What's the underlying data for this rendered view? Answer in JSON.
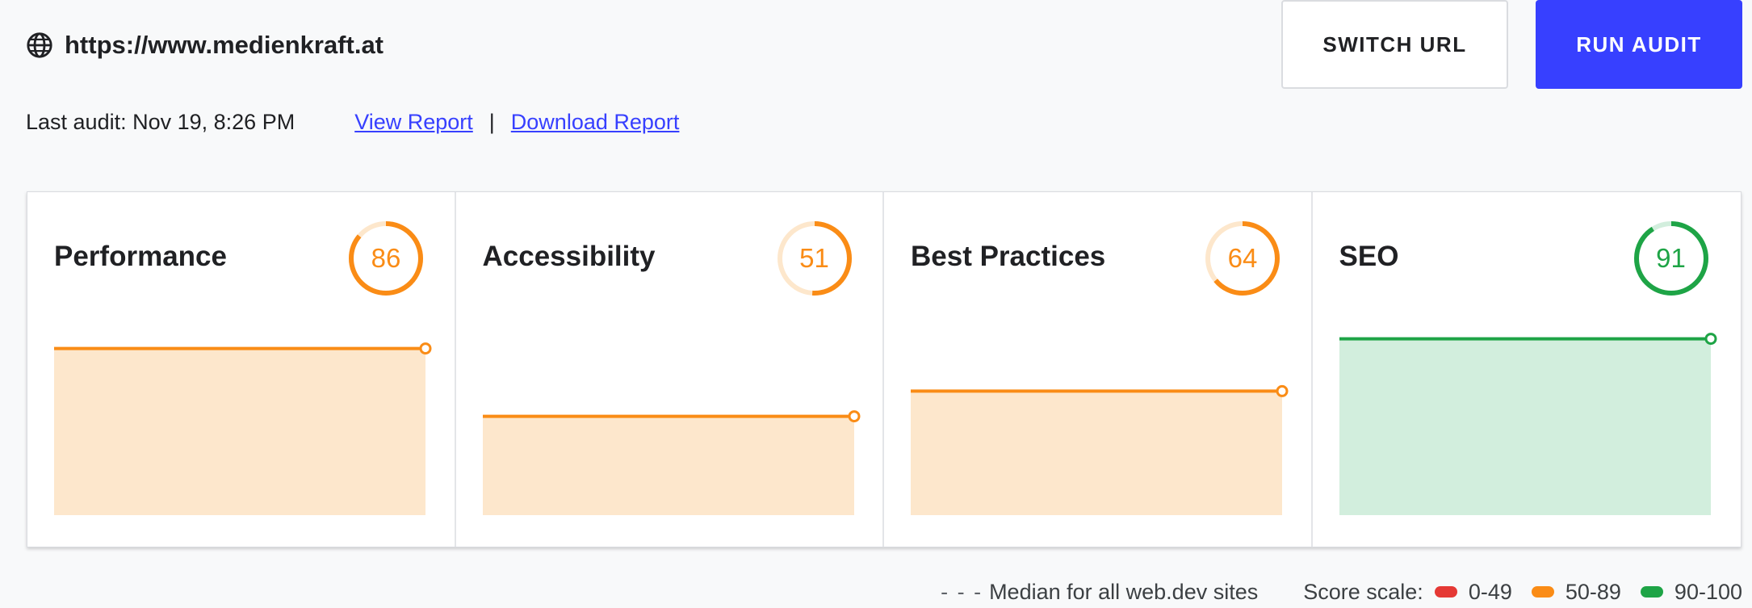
{
  "header": {
    "url": "https://www.medienkraft.at",
    "switch_label": "SWITCH URL",
    "run_label": "RUN AUDIT",
    "last_audit": "Last audit: Nov 19, 8:26 PM",
    "view_report": "View Report",
    "separator": "|",
    "download_report": "Download Report"
  },
  "colors": {
    "orange": "#fa8c16",
    "orange_fill": "#fde7cc",
    "orange_track": "#fde7cc",
    "green": "#1ea446",
    "green_fill": "#d2eedd",
    "green_track": "#d2eedd",
    "red": "#e53935",
    "accent": "#3740ff"
  },
  "cards": [
    {
      "title": "Performance",
      "score": "86",
      "value": 86,
      "status": "orange"
    },
    {
      "title": "Accessibility",
      "score": "51",
      "value": 51,
      "status": "orange"
    },
    {
      "title": "Best Practices",
      "score": "64",
      "value": 64,
      "status": "orange"
    },
    {
      "title": "SEO",
      "score": "91",
      "value": 91,
      "status": "green"
    }
  ],
  "chart_data": [
    {
      "type": "area",
      "series": [
        {
          "values": [
            86,
            86
          ]
        }
      ],
      "ylim": [
        0,
        100
      ]
    },
    {
      "type": "area",
      "series": [
        {
          "values": [
            51,
            51
          ]
        }
      ],
      "ylim": [
        0,
        100
      ]
    },
    {
      "type": "area",
      "series": [
        {
          "values": [
            64,
            64
          ]
        }
      ],
      "ylim": [
        0,
        100
      ]
    },
    {
      "type": "area",
      "series": [
        {
          "values": [
            91,
            91
          ]
        }
      ],
      "ylim": [
        0,
        100
      ]
    }
  ],
  "legend": {
    "dashes": "- - -",
    "median": "Median for all web.dev sites",
    "scale_label": "Score scale:",
    "items": [
      {
        "label": "0-49",
        "color": "#e53935"
      },
      {
        "label": "50-89",
        "color": "#fa8c16"
      },
      {
        "label": "90-100",
        "color": "#1ea446"
      }
    ]
  }
}
